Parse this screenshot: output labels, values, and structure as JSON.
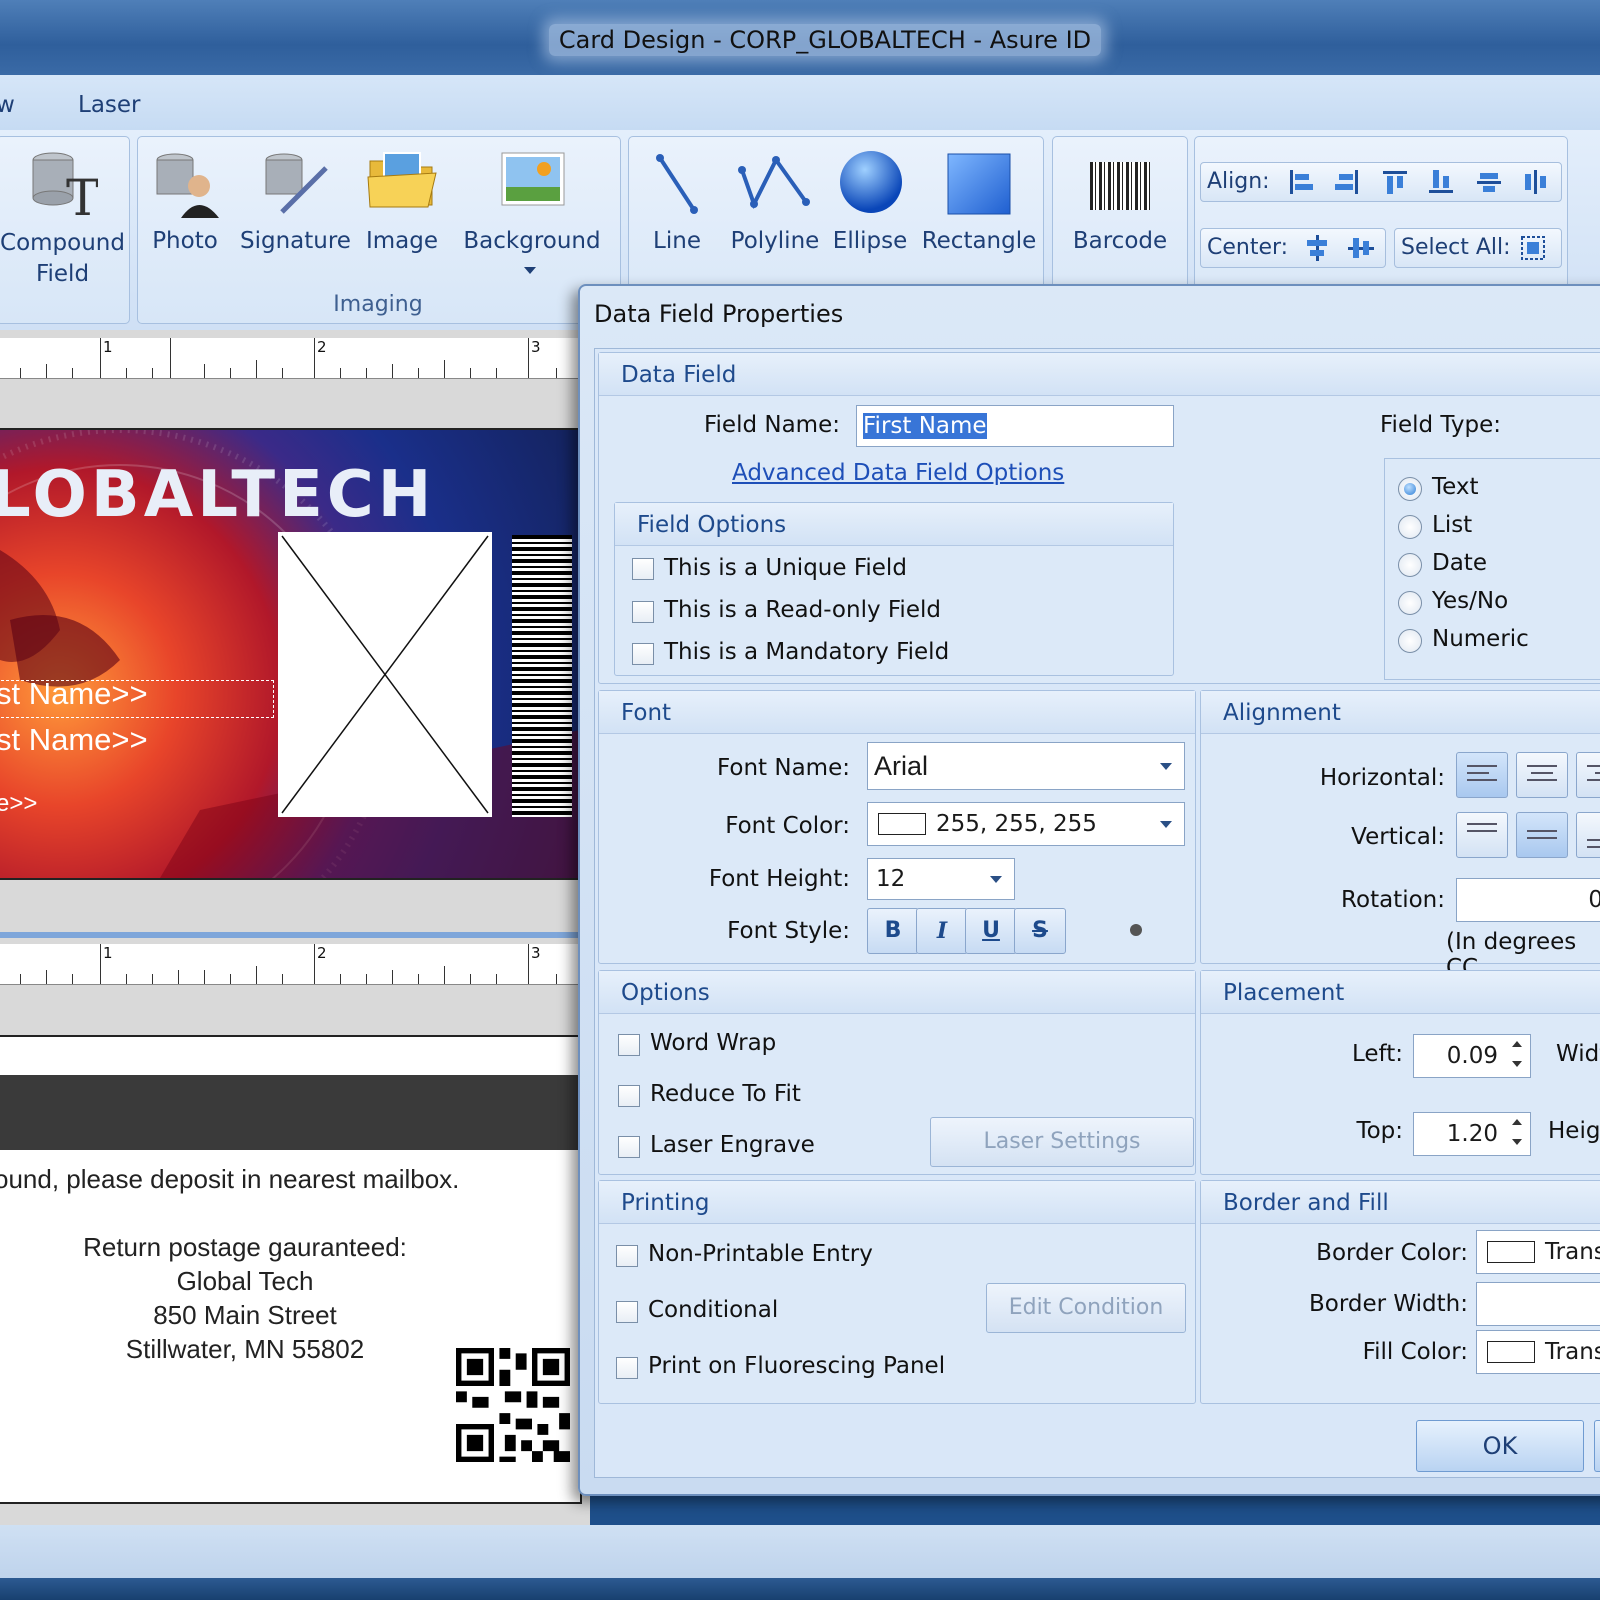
{
  "window": {
    "title": "Card Design - CORP_GLOBALTECH - Asure ID"
  },
  "tabs": {
    "partial": "w",
    "laser": "Laser"
  },
  "ribbon": {
    "compound": "Compound\nField",
    "photo": "Photo",
    "signature": "Signature",
    "image": "Image",
    "background": "Background",
    "imaging_group": "Imaging",
    "line": "Line",
    "polyline": "Polyline",
    "ellipse": "Ellipse",
    "rectangle": "Rectangle",
    "barcode": "Barcode",
    "align": "Align:",
    "center": "Center:",
    "select_all": "Select All:"
  },
  "ruler": {
    "n1": "1",
    "n2": "2",
    "n3": "3"
  },
  "card_front": {
    "title": "LOBALTECH",
    "field1": "st Name>>",
    "field2": "st Name>>",
    "field3": "e>>"
  },
  "card_back": {
    "line1": "ound, please deposit in nearest mailbox.",
    "line2": "Return postage gauranteed:",
    "line3": "Global Tech",
    "line4": "850 Main Street",
    "line5": "Stillwater, MN 55802"
  },
  "dialog": {
    "title": "Data Field Properties",
    "data_field": {
      "header": "Data Field",
      "field_name_label": "Field Name:",
      "field_name_value": "First Name",
      "advanced_link": "Advanced Data Field Options",
      "field_type_label": "Field Type:",
      "field_types": [
        "Text",
        "List",
        "Date",
        "Yes/No",
        "Numeric"
      ],
      "selected_type": "Text"
    },
    "field_options": {
      "header": "Field Options",
      "unique": "This is a Unique Field",
      "readonly": "This is a Read-only Field",
      "mandatory": "This is a Mandatory Field"
    },
    "font": {
      "header": "Font",
      "name_label": "Font Name:",
      "name_value": "Arial",
      "color_label": "Font Color:",
      "color_value": "255, 255, 255",
      "height_label": "Font Height:",
      "height_value": "12",
      "style_label": "Font Style:",
      "bold": "B",
      "italic": "I",
      "underline": "U",
      "strike": "S"
    },
    "alignment": {
      "header": "Alignment",
      "horizontal_label": "Horizontal:",
      "vertical_label": "Vertical:",
      "rotation_label": "Rotation:",
      "rotation_value": "0",
      "rotation_note": "(In degrees CC"
    },
    "options": {
      "header": "Options",
      "word_wrap": "Word Wrap",
      "reduce_to_fit": "Reduce To Fit",
      "laser_engrave": "Laser Engrave",
      "laser_settings": "Laser Settings"
    },
    "placement": {
      "header": "Placement",
      "left_label": "Left:",
      "left_value": "0.09",
      "width_label": "Widt",
      "top_label": "Top:",
      "top_value": "1.20",
      "height_label": "Heigh"
    },
    "printing": {
      "header": "Printing",
      "non_printable": "Non-Printable Entry",
      "conditional": "Conditional",
      "edit_condition": "Edit Condition",
      "fluorescing": "Print on Fluorescing Panel"
    },
    "border_fill": {
      "header": "Border and Fill",
      "border_color_label": "Border Color:",
      "border_color_value": "Trans",
      "border_width_label": "Border Width:",
      "fill_color_label": "Fill Color:",
      "fill_color_value": "Trans"
    },
    "ok": "OK"
  },
  "colors": {
    "accent": "#1e4a8c",
    "selection": "#3875d7",
    "titlebar": "#3a6aa6"
  }
}
